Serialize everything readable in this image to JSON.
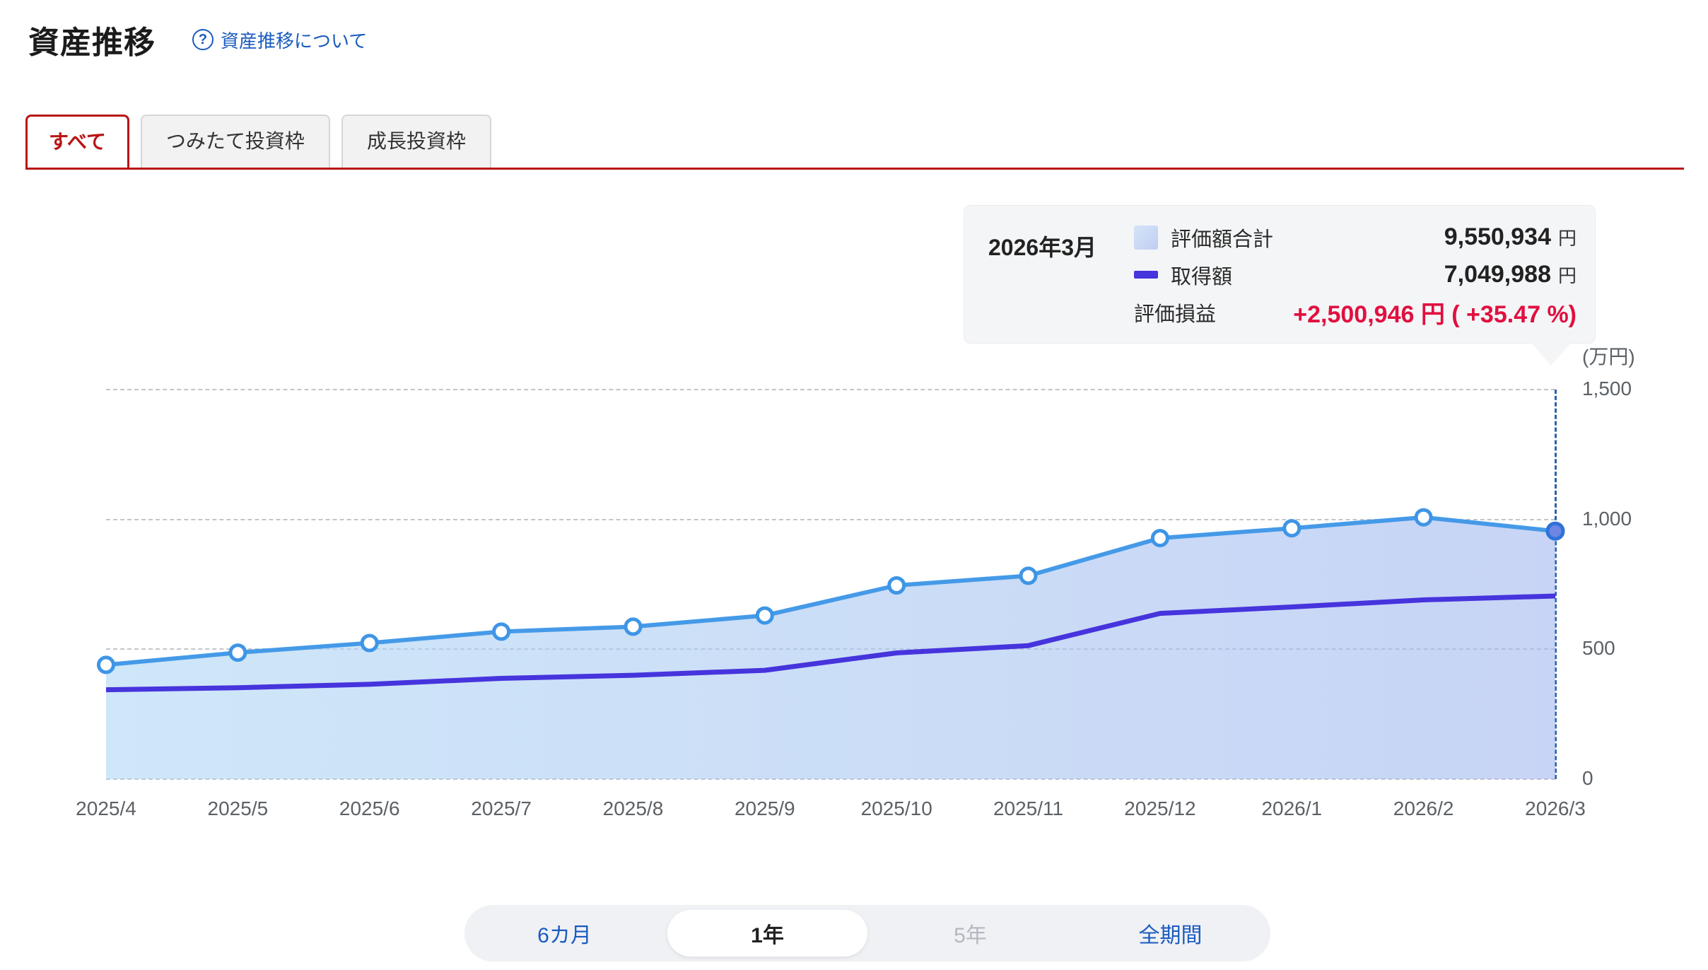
{
  "header": {
    "title": "資産推移",
    "help_link_label": "資産推移について"
  },
  "tabs": [
    {
      "label": "すべて",
      "active": true
    },
    {
      "label": "つみたて投資枠",
      "active": false
    },
    {
      "label": "成長投資枠",
      "active": false
    }
  ],
  "tooltip": {
    "date": "2026年3月",
    "rows": [
      {
        "label": "評価額合計",
        "value": "9,550,934",
        "unit": "円"
      },
      {
        "label": "取得額",
        "value": "7,049,988",
        "unit": "円"
      }
    ],
    "profit_label": "評価損益",
    "profit_value": "+2,500,946 円 ( +35.47 %)"
  },
  "period_selector": {
    "items": [
      {
        "label": "6カ月",
        "state": "normal"
      },
      {
        "label": "1年",
        "state": "active"
      },
      {
        "label": "5年",
        "state": "disabled"
      },
      {
        "label": "全期間",
        "state": "normal"
      }
    ]
  },
  "colors": {
    "accent_red": "#b91414",
    "profit_red": "#e0103f",
    "link_blue": "#1a5bbf",
    "valuation_line_blue": "#459ae8",
    "acquisition_line_purple": "#4634dd",
    "highlight_vline_blue": "#2b63a8"
  },
  "chart_data": {
    "type": "area",
    "title": "資産推移",
    "unit": "万円",
    "axis_unit_label": "(万円)",
    "x_labels": [
      "2025/4",
      "2025/5",
      "2025/6",
      "2025/7",
      "2025/8",
      "2025/9",
      "2025/10",
      "2025/11",
      "2025/12",
      "2026/1",
      "2026/2",
      "2026/3"
    ],
    "ylim": [
      0,
      1500
    ],
    "yticks": [
      0,
      500,
      1000,
      1500
    ],
    "ytick_labels": [
      "0",
      "500",
      "1,000",
      "1,500"
    ],
    "grid": "dashed-horizontal",
    "legend_position": "tooltip",
    "highlight_x": "2026/3",
    "series": [
      {
        "name": "評価額合計",
        "type": "area",
        "color": "#459ae8",
        "marker": "open-circle",
        "values_man_yen": [
          440,
          487,
          524,
          568,
          587,
          630,
          746,
          783,
          928,
          966,
          1008,
          955.09
        ]
      },
      {
        "name": "取得額",
        "type": "line",
        "color": "#4634dd",
        "marker": "none",
        "values_man_yen": [
          344,
          352,
          365,
          388,
          400,
          419,
          486,
          514,
          638,
          663,
          690,
          705.0
        ]
      }
    ]
  }
}
